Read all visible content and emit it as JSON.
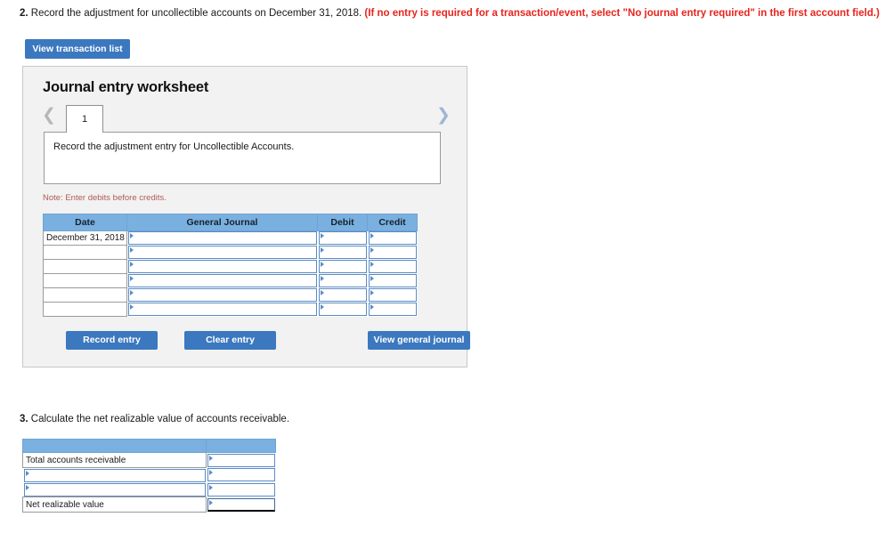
{
  "question2": {
    "number": "2.",
    "text": "Record the adjustment for uncollectible accounts on December 31, 2018.",
    "hint": "(If no entry is required for a transaction/event, select \"No journal entry required\" in the first account field.)",
    "hint_color": "#e8241d",
    "view_transaction_list_label": "View transaction list"
  },
  "worksheet": {
    "title": "Journal entry worksheet",
    "pager": {
      "prev_icon": "chevron-left-icon",
      "next_icon": "chevron-right-icon",
      "tabs": [
        "1"
      ],
      "active_tab": "1"
    },
    "description": "Record the adjustment entry for Uncollectible Accounts.",
    "note": "Note: Enter debits before credits.",
    "note_color": "#b05a5a",
    "table": {
      "headers": [
        "Date",
        "General Journal",
        "Debit",
        "Credit"
      ],
      "header_bg": "#7ab0e0",
      "rows": [
        {
          "date": "December 31, 2018",
          "general_journal": "",
          "debit": "",
          "credit": ""
        },
        {
          "date": "",
          "general_journal": "",
          "debit": "",
          "credit": ""
        },
        {
          "date": "",
          "general_journal": "",
          "debit": "",
          "credit": ""
        },
        {
          "date": "",
          "general_journal": "",
          "debit": "",
          "credit": ""
        },
        {
          "date": "",
          "general_journal": "",
          "debit": "",
          "credit": ""
        },
        {
          "date": "",
          "general_journal": "",
          "debit": "",
          "credit": ""
        }
      ]
    },
    "buttons": {
      "record_entry": "Record entry",
      "clear_entry": "Clear entry",
      "view_general_journal": "View general journal",
      "color": "#3b78bf"
    }
  },
  "question3": {
    "number": "3.",
    "text": "Calculate the net realizable value of accounts receivable.",
    "table": {
      "header_bg": "#7ab0e0",
      "rows": [
        {
          "label": "Total accounts receivable",
          "label_editable": false,
          "value": "",
          "value_style": "normal"
        },
        {
          "label": "",
          "label_editable": true,
          "value": "",
          "value_style": "normal"
        },
        {
          "label": "",
          "label_editable": true,
          "value": "",
          "value_style": "normal"
        },
        {
          "label": "Net realizable value",
          "label_editable": false,
          "value": "",
          "value_style": "dark"
        }
      ]
    }
  }
}
